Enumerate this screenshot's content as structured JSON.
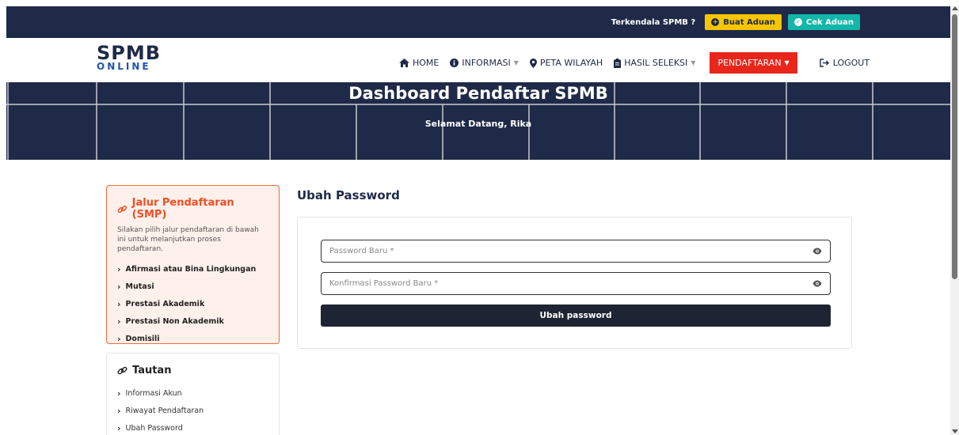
{
  "topbar": {
    "trouble_text": "Terkendala SPMB ?",
    "buat_aduan": "Buat Aduan",
    "cek_aduan": "Cek Aduan"
  },
  "logo": {
    "line1": "SPMB",
    "line2": "ONLINE"
  },
  "nav": {
    "home": "HOME",
    "informasi": "INFORMASI",
    "peta_wilayah": "PETA WILAYAH",
    "hasil_seleksi": "HASIL SELEKSI",
    "pendaftaran": "PENDAFTARAN",
    "logout": "LOGOUT"
  },
  "banner": {
    "title": "Dashboard Pendaftar SPMB",
    "subtitle": "Selamat Datang, Rika"
  },
  "jalur": {
    "title": "Jalur Pendaftaran (SMP)",
    "description": "Silakan pilih jalur pendaftaran di bawah ini untuk melanjutkan proses pendaftaran.",
    "items": [
      "Afirmasi atau Bina Lingkungan",
      "Mutasi",
      "Prestasi Akademik",
      "Prestasi Non Akademik",
      "Domisili"
    ]
  },
  "tautan": {
    "title": "Tautan",
    "items": [
      "Informasi Akun",
      "Riwayat Pendaftaran",
      "Ubah Password"
    ]
  },
  "form": {
    "title": "Ubah Password",
    "password_placeholder": "Password Baru *",
    "confirm_placeholder": "Konfirmasi Password Baru *",
    "submit_label": "Ubah password"
  },
  "colors": {
    "navy": "#1e2a47",
    "yellow": "#f7c600",
    "teal": "#12b7a8",
    "red": "#e8261b",
    "orange": "#f04f23"
  }
}
